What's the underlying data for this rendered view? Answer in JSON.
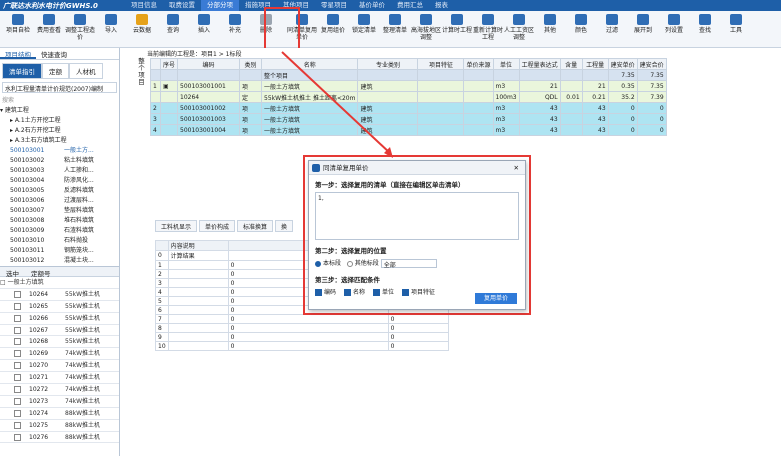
{
  "app": {
    "title": "广联达水利水电计价GWHS.0",
    "menu": [
      "项目信息",
      "取费设置",
      "分部分项",
      "措施项目",
      "其他项目",
      "零星项目",
      "基价单价",
      "费用汇总",
      "报表"
    ],
    "active_menu": "分部分项"
  },
  "toolbar": [
    {
      "label": "项目自检",
      "icon": "check-icon",
      "color": "b"
    },
    {
      "label": "费用查看",
      "icon": "view-icon",
      "color": "b"
    },
    {
      "label": "调整工程造价",
      "icon": "adjust-icon",
      "color": "b"
    },
    {
      "label": "导入",
      "icon": "import-icon",
      "color": "b"
    },
    {
      "label": "云数据",
      "icon": "cloud-icon",
      "color": "y"
    },
    {
      "label": "查询",
      "icon": "query-icon",
      "color": "b"
    },
    {
      "label": "插入",
      "icon": "insert-icon",
      "color": "b"
    },
    {
      "label": "补充",
      "icon": "add-icon",
      "color": "b"
    },
    {
      "label": "删除",
      "icon": "delete-icon",
      "color": "gr"
    },
    {
      "label": "同清单复用单价",
      "icon": "reuse-icon",
      "color": "b"
    },
    {
      "label": "复用组价",
      "icon": "copy-icon",
      "color": "b"
    },
    {
      "label": "锁定清单",
      "icon": "lock-icon",
      "color": "b"
    },
    {
      "label": "整理清单",
      "icon": "sort-icon",
      "color": "b"
    },
    {
      "label": "高海拔地区调整",
      "icon": "mountain-icon",
      "color": "b"
    },
    {
      "label": "计算时工程",
      "icon": "calc-icon",
      "color": "b"
    },
    {
      "label": "重新计算时工程",
      "icon": "recalc-icon",
      "color": "b"
    },
    {
      "label": "人工工资区调整",
      "icon": "wage-icon",
      "color": "b"
    },
    {
      "label": "其他",
      "icon": "other-icon",
      "color": "b"
    },
    {
      "label": "颜色",
      "icon": "color-icon",
      "color": "b"
    },
    {
      "label": "过滤",
      "icon": "filter-icon",
      "color": "b"
    },
    {
      "label": "展开到",
      "icon": "expand-icon",
      "color": "b"
    },
    {
      "label": "列设置",
      "icon": "column-icon",
      "color": "b"
    },
    {
      "label": "查找",
      "icon": "search-icon",
      "color": "b"
    },
    {
      "label": "工具",
      "icon": "tool-icon",
      "color": "b"
    }
  ],
  "left": {
    "tabs": [
      "项目结构",
      "快速查询"
    ],
    "subtabs": [
      "清单指引",
      "定额",
      "人材机"
    ],
    "selector": "水利工程量清单计价规范(2007)编制",
    "search_placeholder": "搜索",
    "tree": [
      {
        "t": "root",
        "label": "建筑工程"
      },
      {
        "t": "sub",
        "label": "A.1土方开挖工程"
      },
      {
        "t": "sub",
        "label": "A.2石方开挖工程"
      },
      {
        "t": "sub",
        "label": "A.3土石方填筑工程"
      },
      {
        "t": "code",
        "code": "500103001",
        "name": "一般土方..."
      },
      {
        "t": "code",
        "code": "500103002",
        "name": "粘土料填筑"
      },
      {
        "t": "code",
        "code": "500103003",
        "name": "人工掺和..."
      },
      {
        "t": "code",
        "code": "500103004",
        "name": "防渗风化..."
      },
      {
        "t": "code",
        "code": "500103005",
        "name": "反滤料填筑"
      },
      {
        "t": "code",
        "code": "500103006",
        "name": "过渡层料..."
      },
      {
        "t": "code",
        "code": "500103007",
        "name": "垫层料填筑"
      },
      {
        "t": "code",
        "code": "500103008",
        "name": "堆石料填筑"
      },
      {
        "t": "code",
        "code": "500103009",
        "name": "石渣料填筑"
      },
      {
        "t": "code",
        "code": "500103010",
        "name": "石料抛投"
      },
      {
        "t": "code",
        "code": "500103011",
        "name": "钢筋笼块..."
      },
      {
        "t": "code",
        "code": "500103012",
        "name": "混凝土块..."
      }
    ],
    "lower_header": [
      "选中",
      "定额号"
    ],
    "lower_group": "一般土方填筑",
    "lower_rows": [
      {
        "code": "10264",
        "name": "55kW推土机"
      },
      {
        "code": "10265",
        "name": "55kW推土机"
      },
      {
        "code": "10266",
        "name": "55kW推土机"
      },
      {
        "code": "10267",
        "name": "55kW推土机"
      },
      {
        "code": "10268",
        "name": "55kW推土机"
      },
      {
        "code": "10269",
        "name": "74kW推土机"
      },
      {
        "code": "10270",
        "name": "74kW推土机"
      },
      {
        "code": "10271",
        "name": "74kW推土机"
      },
      {
        "code": "10272",
        "name": "74kW推土机"
      },
      {
        "code": "10273",
        "name": "74kW推土机"
      },
      {
        "code": "10274",
        "name": "88kW推土机"
      },
      {
        "code": "10275",
        "name": "88kW推土机"
      },
      {
        "code": "10276",
        "name": "88kW推土机"
      }
    ]
  },
  "main": {
    "breadcrumb": "当前编辑的工程是：项目1 > 1标段",
    "side_label": "整个项目",
    "headers": [
      "",
      "序号",
      "编码",
      "类别",
      "名称",
      "专业类别",
      "项目特征",
      "单价来源",
      "单位",
      "工程量表达式",
      "含量",
      "工程量",
      "建安单价",
      "建安合价"
    ],
    "rows": [
      {
        "style": "dark",
        "c": [
          "",
          "",
          "",
          "",
          "整个项目",
          "",
          "",
          "",
          "",
          "",
          "",
          "",
          "7.35",
          "7.35"
        ]
      },
      {
        "style": "green",
        "c": [
          "1",
          "▣",
          "500103001001",
          "项",
          "一般土方填筑",
          "建筑",
          "",
          "",
          "m3",
          "21",
          "",
          "21",
          "0.35",
          "7.35"
        ]
      },
      {
        "style": "green",
        "c": [
          "",
          "",
          "10264",
          "定",
          "55kW推土机推土 推土距离<20m",
          "",
          "",
          "",
          "100m3",
          "QDL",
          "0.01",
          "0.21",
          "35.2",
          "7.39"
        ]
      },
      {
        "style": "cyan",
        "c": [
          "2",
          "",
          "500103001002",
          "项",
          "一般土方填筑",
          "建筑",
          "",
          "",
          "m3",
          "43",
          "",
          "43",
          "0",
          "0"
        ]
      },
      {
        "style": "cyan",
        "c": [
          "3",
          "",
          "500103001003",
          "项",
          "一般土方填筑",
          "建筑",
          "",
          "",
          "m3",
          "43",
          "",
          "43",
          "0",
          "0"
        ]
      },
      {
        "style": "cyan",
        "c": [
          "4",
          "",
          "500103001004",
          "项",
          "一般土方填筑",
          "建筑",
          "",
          "",
          "m3",
          "43",
          "",
          "43",
          "0",
          "0"
        ]
      }
    ],
    "bottom_tabs": [
      "工料机显示",
      "单价构成",
      "标准换算",
      "换"
    ],
    "low_header": [
      "",
      "内容说明",
      "",
      ""
    ],
    "low_rows": [
      [
        "0",
        "计算结果",
        "",
        ""
      ],
      [
        "1",
        "",
        "0",
        ""
      ],
      [
        "2",
        "",
        "0",
        ""
      ],
      [
        "3",
        "",
        "0",
        ""
      ],
      [
        "4",
        "",
        "0",
        ""
      ],
      [
        "5",
        "",
        "0",
        ""
      ],
      [
        "6",
        "",
        "0",
        ""
      ],
      [
        "7",
        "",
        "0",
        "0"
      ],
      [
        "8",
        "",
        "0",
        "0"
      ],
      [
        "9",
        "",
        "0",
        "0"
      ],
      [
        "10",
        "",
        "0",
        "0"
      ]
    ]
  },
  "dialog": {
    "title": "同清单复用单价",
    "step1": "第一步：选择复用的清单（直接在编辑区单击清单）",
    "box_value": "1,",
    "step2": "第二步：选择复用的位置",
    "opt_current": "本标段",
    "opt_other": "其他标段",
    "other_select": "全部",
    "step3": "第三步：选择匹配条件",
    "conds": [
      "编码",
      "名称",
      "单位",
      "项目特征"
    ],
    "button": "复用单价"
  }
}
